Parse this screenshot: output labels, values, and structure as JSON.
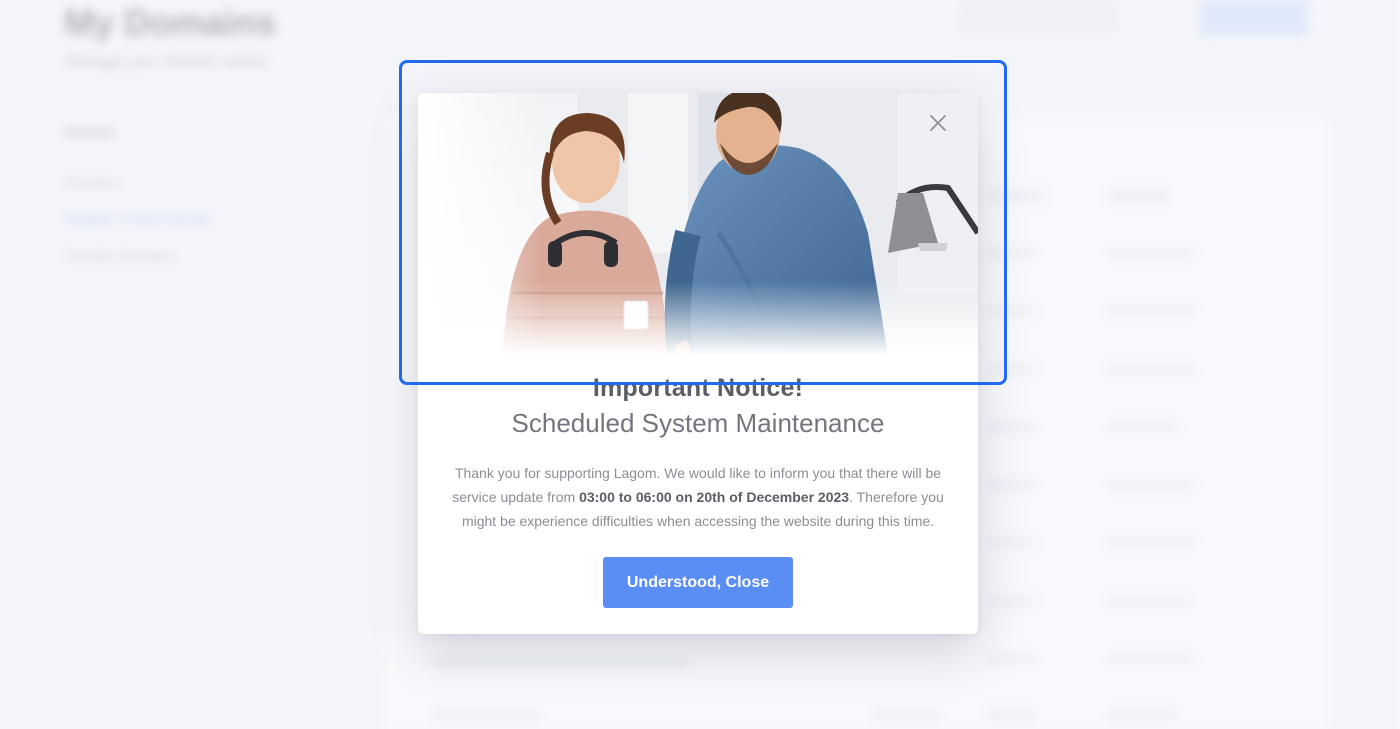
{
  "background": {
    "page_title": "My Domains",
    "page_subtitle": "Manage your domain names",
    "sidebar_heading": "Actions",
    "sidebar_items": [
      "Domains",
      "Register a New Domain",
      "Transfer Domains"
    ]
  },
  "modal": {
    "hero_image_alt": "woman-and-man-at-desk-photo",
    "close_icon": "close-icon",
    "title": "Important Notice!",
    "subtitle": "Scheduled System Maintenance",
    "text_part1": "Thank you for supporting Lagom. We would like to inform you that there will be service update from ",
    "text_highlight": "03:00 to 06:00 on 20th of December 2023",
    "text_part2": ". Therefore you might be experience  difficulties when accessing the website during this time.",
    "button_label": "Understood, Close"
  },
  "colors": {
    "accent": "#5b8ef4",
    "highlight_frame": "#2169f0",
    "title_text": "#5a5e68",
    "body_text": "#8a8e96"
  }
}
